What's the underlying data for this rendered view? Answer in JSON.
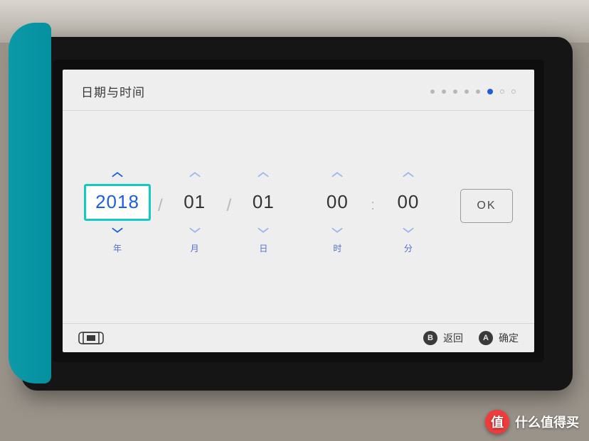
{
  "header": {
    "title": "日期与时间",
    "progress": {
      "total": 8,
      "current_index": 5
    }
  },
  "picker": {
    "fields": [
      {
        "key": "year",
        "value": "2018",
        "label": "年",
        "selected": true
      },
      {
        "key": "month",
        "value": "01",
        "label": "月",
        "selected": false
      },
      {
        "key": "day",
        "value": "01",
        "label": "日",
        "selected": false
      },
      {
        "key": "hour",
        "value": "00",
        "label": "时",
        "selected": false
      },
      {
        "key": "minute",
        "value": "00",
        "label": "分",
        "selected": false
      }
    ],
    "date_separator": "/",
    "time_separator": ":",
    "ok_label": "OK"
  },
  "footer": {
    "hints": [
      {
        "button": "B",
        "label": "返回"
      },
      {
        "button": "A",
        "label": "确定"
      }
    ]
  },
  "watermark": {
    "badge": "值",
    "text": "什么值得买"
  },
  "colors": {
    "accent": "#13c9c3",
    "link": "#1b5fe0"
  }
}
